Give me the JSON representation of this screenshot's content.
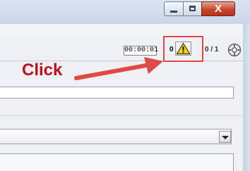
{
  "window": {
    "minimize_icon": "minimize-icon",
    "maximize_icon": "maximize-icon",
    "close_icon": "close-icon",
    "close_glyph": "X"
  },
  "toolbar": {
    "timer": "00:00:01",
    "warning_count": "0",
    "warning_icon": "warning-icon",
    "pager": "0 / 1",
    "settings_icon": "gear-icon"
  },
  "annotation": {
    "label": "Click",
    "color": "#c0111a",
    "highlight_color": "#e24848"
  },
  "form": {
    "input_value": "",
    "dropdown_value": ""
  }
}
